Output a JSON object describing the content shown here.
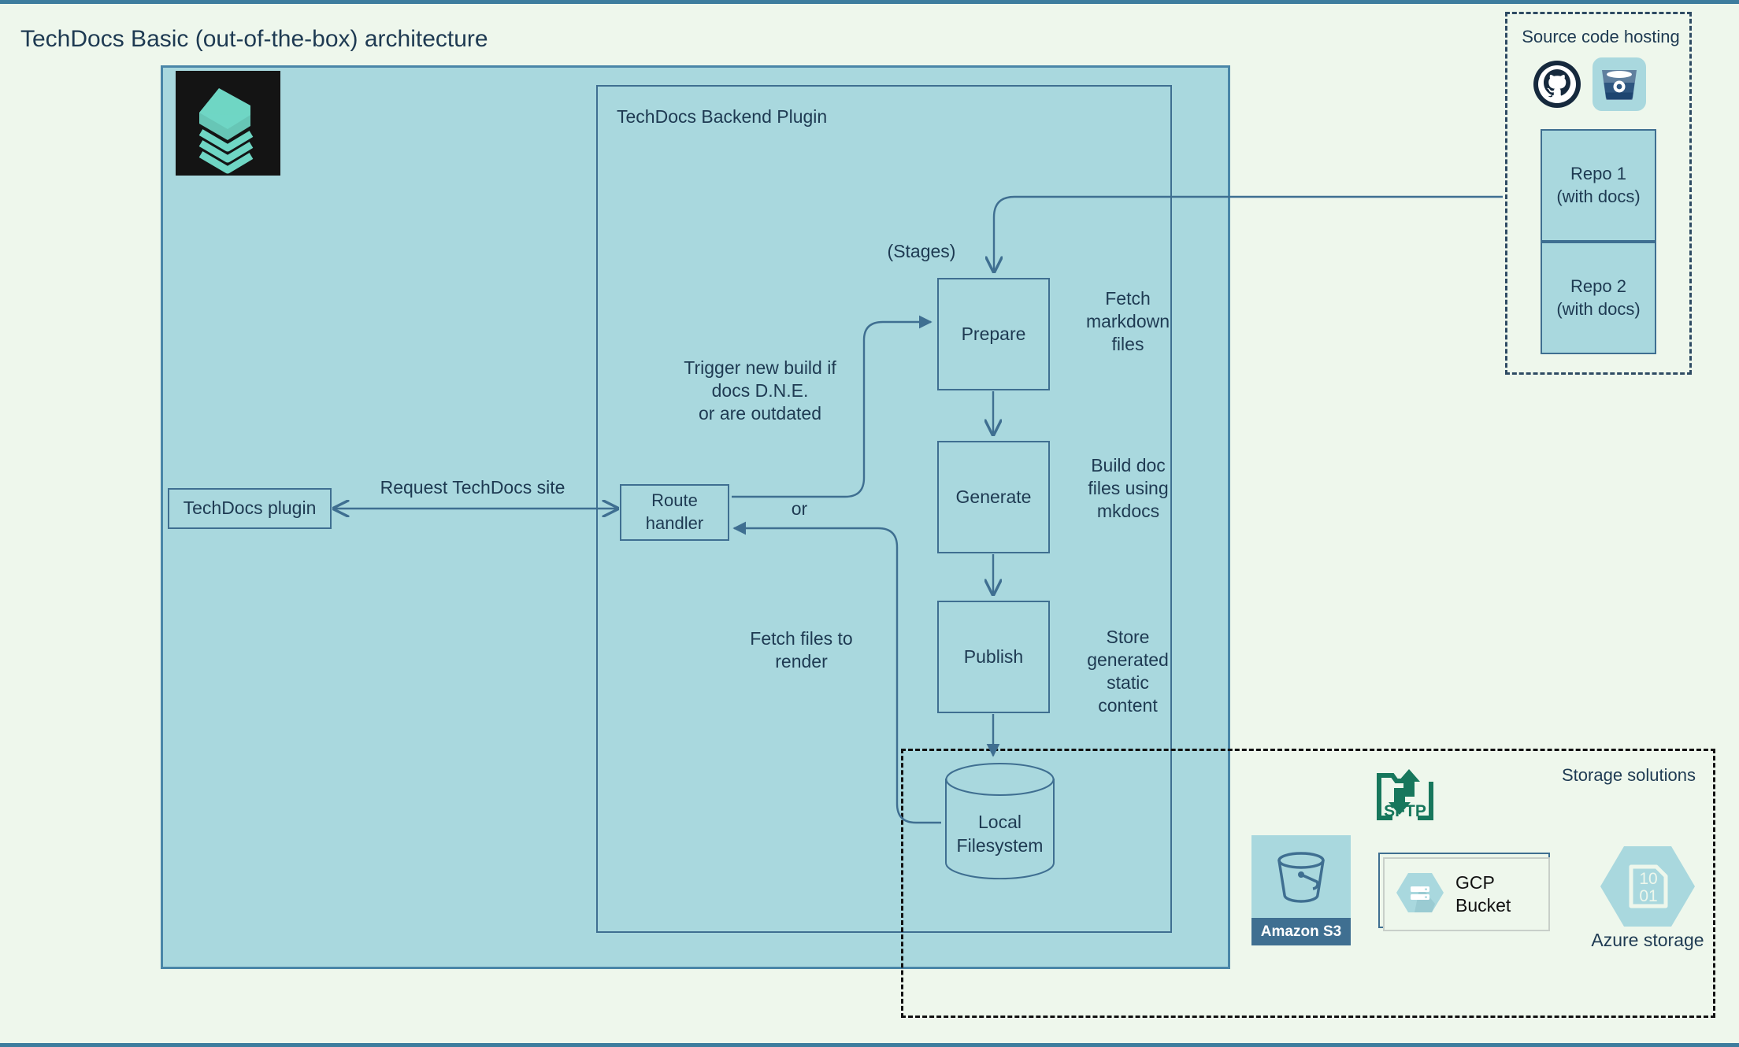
{
  "page": {
    "title": "TechDocs Basic (out-of-the-box) architecture"
  },
  "backstage": {
    "logo_name": "backstage-logo",
    "backend_plugin_title": "TechDocs Backend Plugin"
  },
  "nodes": {
    "techdocs_plugin": "TechDocs plugin",
    "route_handler": "Route\nhandler",
    "prepare": "Prepare",
    "generate": "Generate",
    "publish": "Publish",
    "local_filesystem": "Local\nFilesystem"
  },
  "annotations": {
    "stages": "(Stages)",
    "fetch_markdown": "Fetch\nmarkdown\nfiles",
    "build_doc": "Build doc\nfiles using\nmkdocs",
    "store_static": "Store\ngenerated\nstatic\ncontent",
    "trigger_build": "Trigger new build if\ndocs D.N.E.\nor are outdated",
    "request_site": "Request TechDocs site",
    "or": "or",
    "fetch_files": "Fetch files to\nrender"
  },
  "source_hosting": {
    "title": "Source code hosting",
    "icons": [
      "github-icon",
      "bitbucket-icon"
    ],
    "repos": [
      "Repo 1\n(with docs)",
      "Repo 2\n(with docs)"
    ]
  },
  "storage_solutions": {
    "title": "Storage solutions",
    "items": [
      {
        "name": "amazon-s3",
        "label": "Amazon S3"
      },
      {
        "name": "sftp",
        "label": "SFTP"
      },
      {
        "name": "gcp-bucket",
        "label": "GCP\nBucket"
      },
      {
        "name": "azure-storage",
        "label": "Azure storage"
      }
    ]
  },
  "colors": {
    "page_background": "#eef7ec",
    "container_fill": "#a9d8de",
    "container_border": "#4a86a8",
    "node_border": "#3f6f91",
    "text": "#1e3a52",
    "logo_background": "#141414",
    "logo_accent": "#6fd6c4",
    "sftp_green": "#17775c",
    "s3_label_bar": "#3f6f91"
  }
}
